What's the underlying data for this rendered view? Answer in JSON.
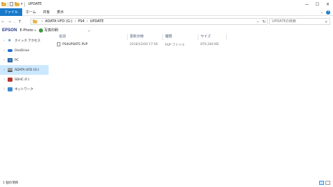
{
  "window": {
    "title": "UPDATE",
    "minimize": "—",
    "maximize": "☐",
    "close": "✕"
  },
  "ribbon": {
    "tabs": [
      "ファイル",
      "ホーム",
      "共有",
      "表示"
    ]
  },
  "address": {
    "crumbs": [
      "ADATA UFD (G:)",
      "PS4",
      "UPDATE"
    ],
    "separator": "›"
  },
  "search": {
    "placeholder": "UPDATEの検索"
  },
  "epson": {
    "logo": "EPSON",
    "item1": "E-Photo",
    "item2": "写真印刷"
  },
  "nav": {
    "items": [
      {
        "label": "クイック アクセス",
        "icon": "star-icon"
      },
      {
        "label": "OneDrive",
        "icon": "cloud-icon"
      },
      {
        "label": "PC",
        "icon": "pc-icon"
      },
      {
        "label": "ADATA UFD (G:)",
        "icon": "usb-drive-icon",
        "selected": true
      },
      {
        "label": "SDHC (F:)",
        "icon": "sd-card-icon"
      },
      {
        "label": "ネットワーク",
        "icon": "network-icon"
      }
    ]
  },
  "columns": {
    "name": "名前",
    "date": "更新日時",
    "type": "種類",
    "size": "サイズ"
  },
  "files": [
    {
      "name": "PS4UPDATE.PUP",
      "date": "2016/12/04 17:50",
      "type": "PUP ファイル",
      "size": "870,340 KB"
    }
  ],
  "status": {
    "count": "1 個の項目"
  }
}
